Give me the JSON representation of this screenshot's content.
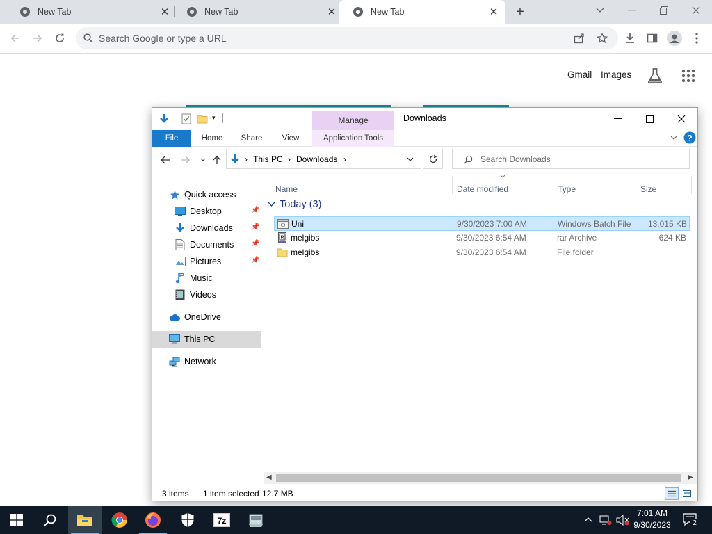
{
  "browser": {
    "tabs": [
      {
        "title": "New Tab",
        "active": false
      },
      {
        "title": "New Tab",
        "active": false
      },
      {
        "title": "New Tab",
        "active": true
      }
    ],
    "omnibox_placeholder": "Search Google or type a URL",
    "ntp_links": {
      "gmail": "Gmail",
      "images": "Images"
    }
  },
  "explorer": {
    "window_title": "Downloads",
    "manage_label": "Manage",
    "ribbon_tabs": {
      "file": "File",
      "home": "Home",
      "share": "Share",
      "view": "View",
      "app_tools": "Application Tools"
    },
    "breadcrumb": {
      "root": "This PC",
      "current": "Downloads"
    },
    "search_placeholder": "Search Downloads",
    "nav_pane": {
      "quick_access": "Quick access",
      "desktop": "Desktop",
      "downloads": "Downloads",
      "documents": "Documents",
      "pictures": "Pictures",
      "music": "Music",
      "videos": "Videos",
      "onedrive": "OneDrive",
      "this_pc": "This PC",
      "network": "Network"
    },
    "columns": {
      "name": "Name",
      "date": "Date modified",
      "type": "Type",
      "size": "Size"
    },
    "group": {
      "label": "Today (3)"
    },
    "files": [
      {
        "name": "Uni",
        "date": "9/30/2023 7:00 AM",
        "type": "Windows Batch File",
        "size": "13,015 KB",
        "icon": "batch-file-icon",
        "selected": true
      },
      {
        "name": "melgibs",
        "date": "9/30/2023 6:54 AM",
        "type": "rar Archive",
        "size": "624 KB",
        "icon": "rar-archive-icon",
        "selected": false
      },
      {
        "name": "melgibs",
        "date": "9/30/2023 6:54 AM",
        "type": "File folder",
        "size": "",
        "icon": "folder-icon",
        "selected": false
      }
    ],
    "status": {
      "items": "3 items",
      "selection": "1 item selected",
      "size": "12.7 MB"
    }
  },
  "taskbar": {
    "time": "7:01 AM",
    "date": "9/30/2023",
    "notification_count": "2",
    "apps": [
      "start-icon",
      "search-icon",
      "file-explorer-icon",
      "chrome-icon",
      "firefox-icon",
      "security-icon",
      "7zip-icon",
      "app-icon"
    ]
  },
  "colors": {
    "accent": "#1979ca",
    "selection": "#cce8ff",
    "manage_tab": "#e9d1f3",
    "taskbar": "#101a26"
  }
}
